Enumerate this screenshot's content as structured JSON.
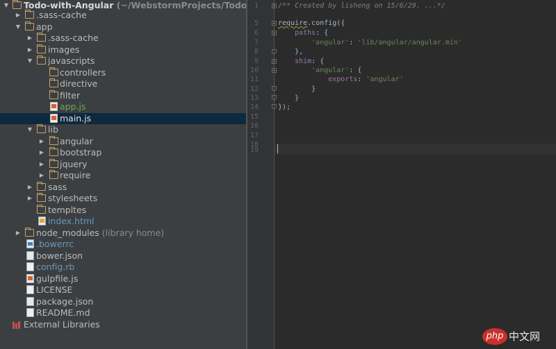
{
  "tree": {
    "root": {
      "name": "Todo-with-Angular",
      "suffix": "(~/WebstormProjects/Todo-with"
    },
    "items": [
      {
        "label": "Todo-with-Angular"
      },
      {
        "label": ".sass-cache"
      },
      {
        "label": "app"
      },
      {
        "label": ".sass-cache"
      },
      {
        "label": "images"
      },
      {
        "label": "javascripts"
      },
      {
        "label": "controllers"
      },
      {
        "label": "directive"
      },
      {
        "label": "filter"
      },
      {
        "label": "app.js"
      },
      {
        "label": "main.js"
      },
      {
        "label": "lib"
      },
      {
        "label": "angular"
      },
      {
        "label": "bootstrap"
      },
      {
        "label": "jquery"
      },
      {
        "label": "require"
      },
      {
        "label": "sass"
      },
      {
        "label": "stylesheets"
      },
      {
        "label": "templtes"
      },
      {
        "label": "index.html"
      },
      {
        "label": "node_modules",
        "suffix": "(library home)"
      },
      {
        "label": ".bowerrc"
      },
      {
        "label": "bower.json"
      },
      {
        "label": "config.rb"
      },
      {
        "label": "gulpfile.js"
      },
      {
        "label": "LICENSE"
      },
      {
        "label": "package.json"
      },
      {
        "label": "README.md"
      },
      {
        "label": "External Libraries"
      }
    ]
  },
  "editor": {
    "line_numbers": [
      "1",
      "5",
      "6",
      "7",
      "8",
      "9",
      "10",
      "11",
      "12",
      "13",
      "14",
      "15",
      "16",
      "17",
      "18",
      "19"
    ],
    "lines": {
      "l1": "/** Created by lisheng on 15/6/29. ...*/",
      "l5a": "require",
      "l5b": ".config({",
      "l6a": "    paths",
      "l6b": ": {",
      "l7a": "        'angular'",
      "l7b": ": ",
      "l7c": "'lib/angular/angular.min'",
      "l8": "    },",
      "l9a": "    shim",
      "l9b": ": {",
      "l10a": "        'angular'",
      "l10b": ": {",
      "l11a": "            exports",
      "l11b": ": ",
      "l11c": "'angular'",
      "l12": "        }",
      "l13": "    }",
      "l14": "});"
    }
  },
  "watermark": {
    "logo": "php",
    "text": "中文网"
  }
}
